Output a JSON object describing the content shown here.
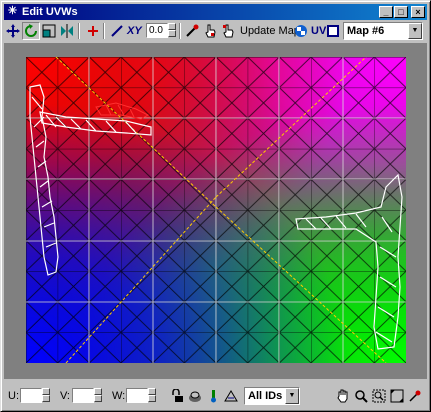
{
  "window": {
    "title": "Edit UVWs",
    "icon": "asterisk-icon",
    "controls": [
      "minimize",
      "maximize",
      "close"
    ]
  },
  "toolbar": {
    "tools": [
      "move-icon",
      "rotate-icon",
      "scale-icon",
      "mirror-icon",
      "add-point-icon",
      "line-icon",
      "xy-icon",
      "eyedropper-icon",
      "hand-pointer-icon",
      "hand-pointer-2-icon"
    ],
    "xy_label": "XY",
    "value": "0.0",
    "update_map_label": "Update Map",
    "uv_label": "UV",
    "map_select": "Map #6"
  },
  "bottom": {
    "u_label": "U:",
    "v_label": "V:",
    "w_label": "W:",
    "u_value": "",
    "v_value": "",
    "w_value": "",
    "ids_select": "All IDs"
  },
  "colors": {
    "titlebar_start": "#000080",
    "titlebar_end": "#1084d0",
    "background": "#c0c0c0",
    "viewport_bg": "#808080",
    "grid_white": "#ffffff",
    "grid_dark": "#000000",
    "diagonal": "#ffcc00",
    "selection": "#ff2020"
  }
}
